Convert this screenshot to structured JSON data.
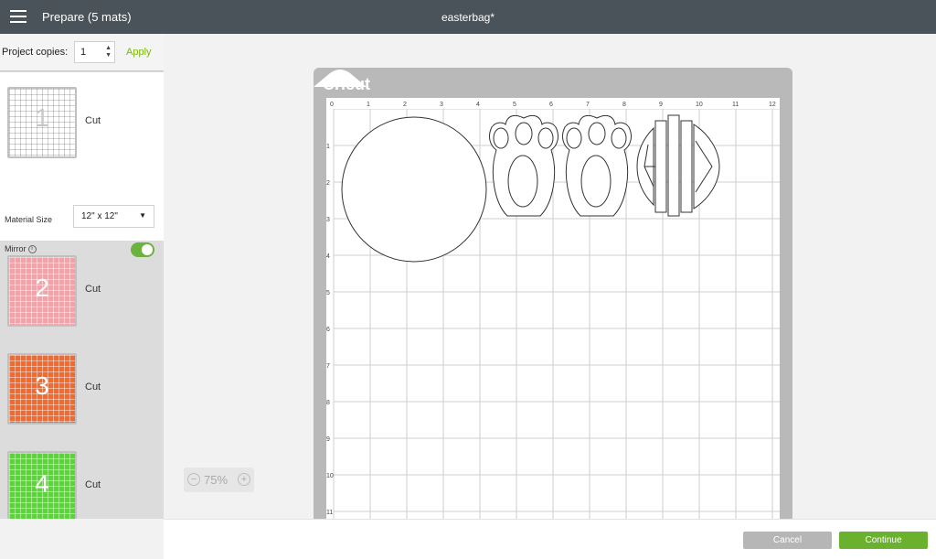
{
  "header": {
    "title": "Prepare (5 mats)",
    "project_name": "easterbag*"
  },
  "left_panel": {
    "copies_label": "Project copies:",
    "copies_value": "1",
    "apply_label": "Apply",
    "material_size_label": "Material Size",
    "material_size_value": "12\" x 12\"",
    "mirror_label": "Mirror",
    "mirror_on": true,
    "mats": [
      {
        "number": "1",
        "label": "Cut",
        "color": "#ffffff"
      },
      {
        "number": "2",
        "label": "Cut",
        "color": "#f2a2a8"
      },
      {
        "number": "3",
        "label": "Cut",
        "color": "#f26a2e"
      },
      {
        "number": "4",
        "label": "Cut",
        "color": "#5bd43a"
      }
    ]
  },
  "zoom": {
    "value": "75%",
    "minus": "−",
    "plus": "+"
  },
  "mat": {
    "brand": "Cricut",
    "ruler_top": [
      "0",
      "1",
      "2",
      "3",
      "4",
      "5",
      "6",
      "7",
      "8",
      "9",
      "10",
      "11",
      "12"
    ],
    "ruler_left": [
      "1",
      "2",
      "3",
      "4",
      "5",
      "6",
      "7",
      "8",
      "9",
      "10",
      "11"
    ]
  },
  "footer": {
    "cancel_label": "Cancel",
    "continue_label": "Continue"
  },
  "colors": {
    "accent": "#7ab800",
    "toggle_on": "#6cb33e",
    "topbar": "#4a5359"
  }
}
